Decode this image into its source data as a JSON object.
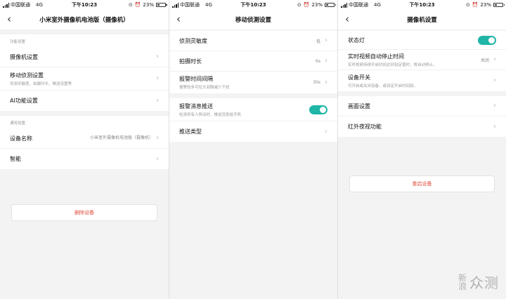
{
  "status_bar": {
    "carrier": "中国联通",
    "network": "4G",
    "time": "下午10:23",
    "battery": "23%",
    "battery_level": 0.23
  },
  "screens": [
    {
      "title": "小米室外摄像机电池版（摄像机）",
      "sections": [
        {
          "label": "功能设置",
          "items": [
            {
              "label": "摄像机设置",
              "sub": "",
              "value": ""
            },
            {
              "label": "移动侦测设置",
              "sub": "侦测灵敏度、拍摄时长、推送设置等",
              "value": ""
            },
            {
              "label": "AI功能设置",
              "sub": "",
              "value": ""
            }
          ]
        },
        {
          "label": "通用设置",
          "items": [
            {
              "label": "设备名称",
              "sub": "",
              "value": "小米室外摄像机电池版（摄像机）"
            },
            {
              "label": "智能",
              "sub": "",
              "value": ""
            }
          ]
        }
      ],
      "button": "删除设备"
    },
    {
      "title": "移动侦测设置",
      "items": [
        {
          "label": "侦测灵敏度",
          "sub": "",
          "value": "低"
        },
        {
          "label": "拍摄时长",
          "sub": "",
          "value": "6s"
        },
        {
          "label": "报警时间间隔",
          "sub": "报警较多可拉大间隔减少干扰",
          "value": "30s"
        },
        {
          "label": "报警消息推送",
          "sub": "检测到有人移动时，推送消息给手机",
          "toggle": true
        },
        {
          "label": "推送类型",
          "sub": "",
          "value": ""
        }
      ]
    },
    {
      "title": "摄像机设置",
      "items": [
        {
          "label": "状态灯",
          "toggle": true
        },
        {
          "label": "实时视频自动停止时间",
          "sub": "实时视频持续开启时间达到设定值时，将自动停止。",
          "value": "关闭"
        },
        {
          "label": "设备开关",
          "sub": "可开启或关闭设备，或设定开启时间段。",
          "value": ""
        },
        {
          "label": "画面设置",
          "value": ""
        },
        {
          "label": "红外夜视功能",
          "value": ""
        }
      ],
      "button": "重启设备"
    }
  ],
  "watermark": {
    "left": "新浪",
    "right": "众测"
  },
  "colors": {
    "accent": "#1fb5a7",
    "danger": "#e24b3b"
  }
}
